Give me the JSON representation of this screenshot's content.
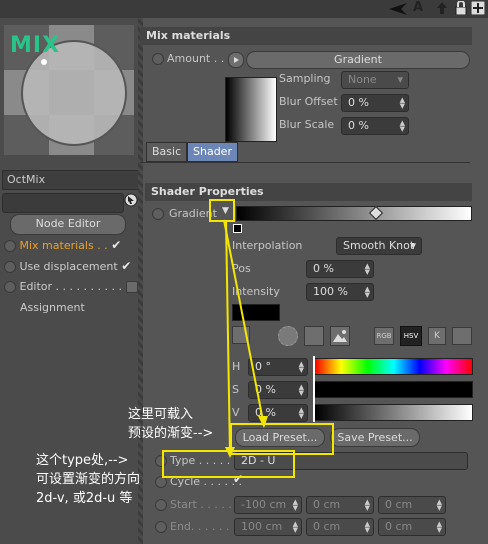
{
  "topbar": {
    "icons": [
      "arrow-icon",
      "font-icon",
      "lock-icon",
      "add-icon"
    ]
  },
  "preview": {
    "label": "MIX"
  },
  "object": {
    "name": "OctMix"
  },
  "left": {
    "node_editor": "Node Editor",
    "items": [
      {
        "label": "Mix materials . .",
        "active": true,
        "checked": true
      },
      {
        "label": "Use displacement",
        "active": false,
        "checked": true
      },
      {
        "label": "Editor . . . . . . . . . .",
        "active": false,
        "checked": false
      },
      {
        "label": "Assignment",
        "active": false,
        "checked": false
      }
    ]
  },
  "mix_materials": {
    "title": "Mix materials",
    "amount_label": "Amount . . . .",
    "amount_value": "Gradient",
    "sampling_label": "Sampling",
    "sampling_value": "None",
    "blur_offset_label": "Blur Offset",
    "blur_offset_value": "0 %",
    "blur_scale_label": "Blur Scale",
    "blur_scale_value": "0 %"
  },
  "tabs": {
    "basic": "Basic",
    "shader": "Shader"
  },
  "shader": {
    "title": "Shader Properties",
    "gradient_label": "Gradient",
    "interpolation_label": "Interpolation",
    "interpolation_value": "Smooth Knot",
    "pos_label": "Pos",
    "pos_value": "0 %",
    "intensity_label": "Intensity",
    "intensity_value": "100 %",
    "mode_buttons": [
      "RGB",
      "HSV",
      "K"
    ],
    "h_label": "H",
    "h_value": "0 °",
    "s_label": "S",
    "s_value": "0 %",
    "v_label": "V",
    "v_value": "0 %",
    "load_preset": "Load Preset...",
    "save_preset": "Save Preset...",
    "type_label": "Type . . . . . . .",
    "type_value": "2D - U",
    "cycle_label": "Cycle . . . . . .",
    "start_label": "Start . . . . . .",
    "start_values": [
      "-100 cm",
      "0 cm",
      "0 cm"
    ],
    "end_label": "End. . . . . . .",
    "end_values": [
      "100 cm",
      "0 cm",
      "0 cm"
    ]
  },
  "annotations": {
    "preset_line1": "这里可载入",
    "preset_line2": "预设的渐变-->",
    "type_line1": "这个type处,-->",
    "type_line2": "可设置渐变的方向",
    "type_line3": "2d-v, 或2d-u 等"
  },
  "colors": {
    "accent": "#f3e600",
    "active_item": "#e8a12a",
    "mix_label": "#29c48a",
    "shader_tab": "#6d86b8"
  }
}
